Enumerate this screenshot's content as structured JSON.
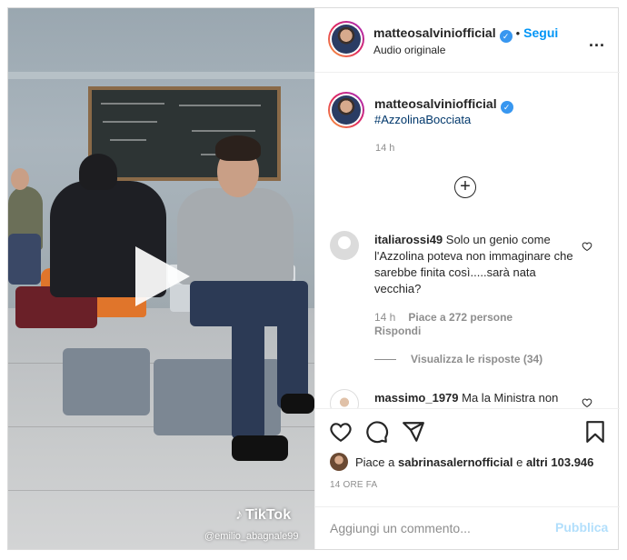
{
  "header": {
    "username": "matteosalviniofficial",
    "verified_icon": "verified-badge-icon",
    "separator": "•",
    "follow_label": "Segui",
    "subline": "Audio originale",
    "more_label": "..."
  },
  "caption": {
    "username": "matteosalviniofficial",
    "hashtag": "#AzzolinaBocciata",
    "time_ago": "14 h"
  },
  "load_more": {
    "icon": "plus-circle-icon",
    "label": "+"
  },
  "comments": [
    {
      "username": "italiarossi49",
      "text": "Solo un genio come l'Azzolina poteva non immaginare che sarebbe finita così.....sarà nata vecchia?",
      "time": "14 h",
      "likes": "Piace a 272 persone",
      "reply": "Rispondi",
      "view_replies": "Visualizza le risposte (34)"
    },
    {
      "username": "massimo_1979",
      "text": "Ma la Ministra non"
    }
  ],
  "video": {
    "watermark": "TikTok",
    "watermark_user": "@emilio_abagnale99",
    "play_icon": "play-icon"
  },
  "actions": {
    "like_icon": "heart-icon",
    "comment_icon": "comment-icon",
    "share_icon": "paper-plane-icon",
    "save_icon": "bookmark-icon",
    "likes_prefix": "Piace a",
    "likes_user": "sabrinasalernofficial",
    "likes_suffix_e": "e",
    "likes_others": "altri 103.946",
    "date": "14 ORE FA"
  },
  "add_comment": {
    "placeholder": "Aggiungi un commento...",
    "publish_label": "Pubblica"
  },
  "colors": {
    "accent": "#0095f6",
    "publish_disabled": "#b2dffc",
    "border": "#dbdbdb",
    "muted": "#8e8e8e",
    "text": "#262626",
    "hashtag": "#00376b"
  }
}
